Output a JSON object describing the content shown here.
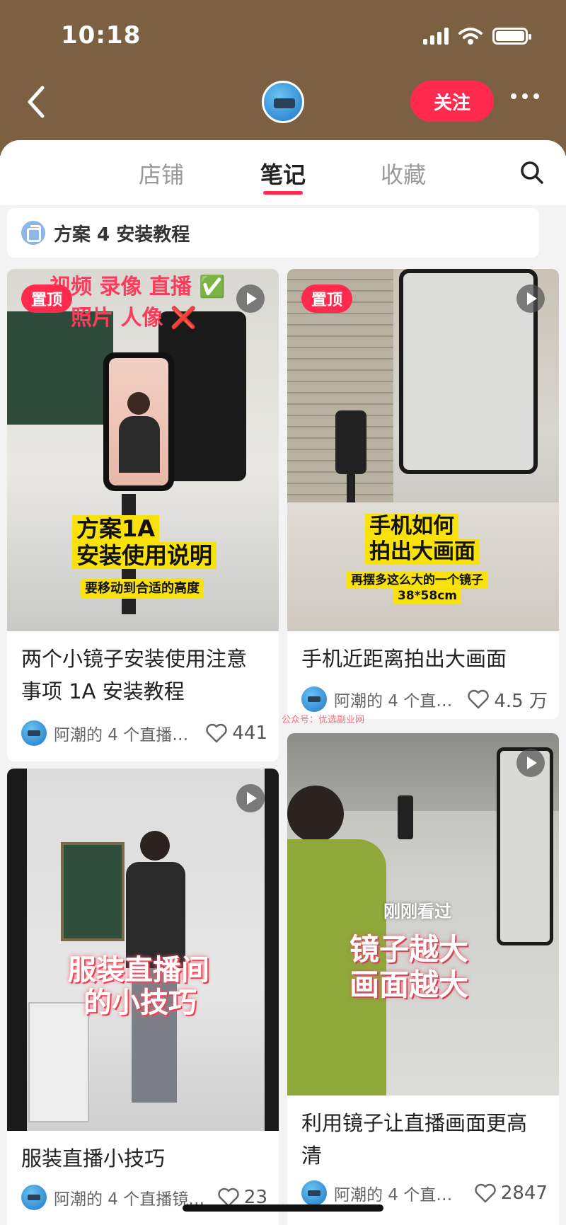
{
  "status_bar": {
    "time": "10:18"
  },
  "header": {
    "follow_label": "关注"
  },
  "tabs": [
    {
      "label": "店铺",
      "active": false
    },
    {
      "label": "笔记",
      "active": true
    },
    {
      "label": "收藏",
      "active": false
    }
  ],
  "collection": {
    "label": "方案 4 安装教程"
  },
  "notes": [
    {
      "pinned_label": "置顶",
      "cover_text": [
        "视频 录像 直播 ✅",
        "照片 人像 ❌",
        "方案1A",
        "安装使用说明",
        "要移动到合适的高度"
      ],
      "title": "两个小镜子安装使用注意事项 1A 安装教程",
      "author": "阿潮的 4 个直播…",
      "likes": "441"
    },
    {
      "pinned_label": "置顶",
      "cover_text": [
        "手机如何",
        "拍出大画面",
        "再摆多这么大的一个镜子",
        "38*58cm"
      ],
      "title": "手机近距离拍出大画面",
      "author": "阿潮的 4 个直…",
      "likes": "4.5 万"
    },
    {
      "cover_text": [
        "服装直播间",
        "的小技巧"
      ],
      "title": "服装直播小技巧",
      "author": "阿潮的 4 个直播镜…",
      "likes": "23"
    },
    {
      "cover_text": [
        "刚刚看过",
        "镜子越大",
        "画面越大"
      ],
      "title": "利用镜子让直播画面更高清",
      "author": "阿潮的 4 个直…",
      "likes": "2847"
    }
  ],
  "watermark": "公众号：优选副业网",
  "colors": {
    "header_bg": "#7b6142",
    "accent": "#ff2a4e",
    "cover_highlight": "#f8e20a"
  },
  "icons": [
    "back-icon",
    "more-icon",
    "search-icon",
    "play-icon",
    "heart-icon",
    "collection-icon"
  ]
}
